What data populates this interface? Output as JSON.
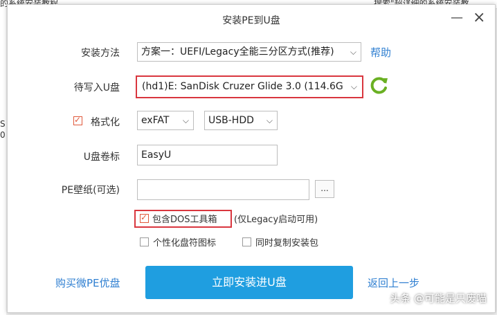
{
  "background": {
    "top_text_left": "的系统安装教程",
    "top_text_right": "搜索\"超详细的系统安装教",
    "left_text_1": "S",
    "left_text_2": "0"
  },
  "dialog": {
    "title": "安装PE到U盘",
    "minimize": "—",
    "close": "×"
  },
  "form": {
    "install_method_label": "安装方法",
    "install_method_value": "方案一：UEFI/Legacy全能三分区方式(推荐)",
    "help_link": "帮助",
    "usb_label": "待写入U盘",
    "usb_value": "(hd1)E: SanDisk Cruzer Glide 3.0 (114.6G",
    "format_label": "格式化",
    "fs_value": "exFAT",
    "mode_value": "USB-HDD",
    "volume_label": "U盘卷标",
    "volume_value": "EasyU",
    "wallpaper_label": "PE壁纸(可选)",
    "wallpaper_value": "",
    "browse_button": "...",
    "dos_toolbox": "包含DOS工具箱",
    "dos_note": "(仅Legacy启动可用)",
    "custom_icon": "个性化盘符图标",
    "copy_installer": "同时复制安装包"
  },
  "footer": {
    "buy_link": "购买微PE优盘",
    "install_button": "立即安装进U盘",
    "back_link": "返回上一步"
  },
  "watermark": "头条 @可能是只废喵",
  "colors": {
    "accent": "#1f9ee0",
    "link": "#2f7fd1",
    "highlight": "#d9363e",
    "refresh": "#6ab023"
  }
}
